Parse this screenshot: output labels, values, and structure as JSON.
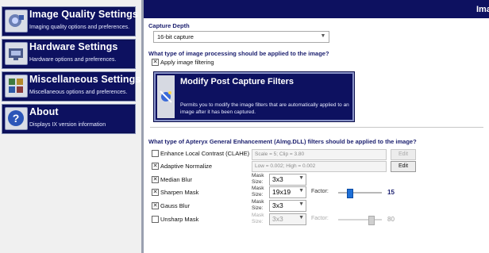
{
  "sidebar": {
    "items": [
      {
        "title": "Image Quality Settings",
        "desc": "Imaging quality options and preferences.",
        "icon": "image-quality-icon"
      },
      {
        "title": "Hardware Settings",
        "desc": "Hardware options and preferences.",
        "icon": "hardware-icon"
      },
      {
        "title": "Miscellaneous Settings",
        "desc": "Miscellaneous options and preferences.",
        "icon": "misc-settings-icon"
      },
      {
        "title": "About",
        "desc": "Displays IX version information",
        "icon": "help-icon"
      }
    ]
  },
  "header": {
    "title": "Ima"
  },
  "capture": {
    "label": "Capture Depth",
    "value": "16-bit capture"
  },
  "processing": {
    "question": "What type of image processing should be applied to the image?",
    "apply_label": "Apply image filtering",
    "apply_checked": true
  },
  "post_filters": {
    "title": "Modify Post Capture Filters",
    "desc": "Permits you to modify the image filters that are automatically applied to an image after it has been captured."
  },
  "enhancement": {
    "question": "What type of Apteryx General Enhancement (Almg.DLL) filters should be applied to the image?",
    "clahe": {
      "label": "Enhance Local Contrast (CLAHE)",
      "checked": false,
      "params": "Scale = 5; Clip = 3.80",
      "edit": "Edit"
    },
    "adaptive": {
      "label": "Adaptive Normalize",
      "checked": true,
      "params": "Low = 0.002; High = 0.002",
      "edit": "Edit"
    },
    "median": {
      "label": "Median Blur",
      "checked": true,
      "mask_label": "Mask Size:",
      "mask": "3x3"
    },
    "sharpen": {
      "label": "Sharpen Mask",
      "checked": true,
      "mask_label": "Mask Size:",
      "mask": "19x19",
      "factor_label": "Factor:",
      "factor": "15",
      "factor_frac": 0.22
    },
    "gauss": {
      "label": "Gauss Blur",
      "checked": true,
      "mask_label": "Mask Size:",
      "mask": "3x3"
    },
    "unsharp": {
      "label": "Unsharp Mask",
      "checked": false,
      "mask_label": "Mask Size:",
      "mask": "3x3",
      "factor_label": "Factor:",
      "factor": "80",
      "factor_frac": 0.78
    }
  },
  "colors": {
    "nav_bg": "#0d1160",
    "accent": "#1e6fd6"
  }
}
